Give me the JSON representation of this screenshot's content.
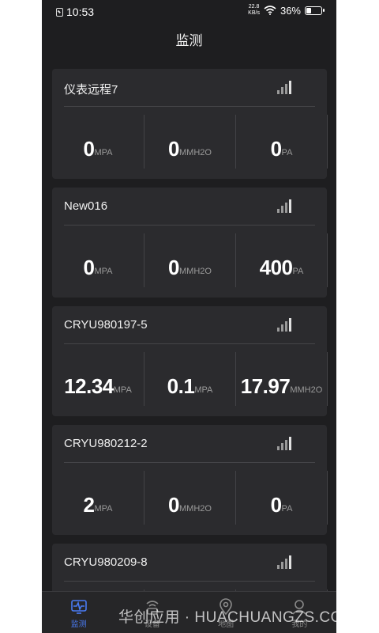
{
  "status_bar": {
    "time": "10:53",
    "net_speed_value": "22.8",
    "net_speed_unit": "KB/s",
    "battery_pct": "36%",
    "battery_level": 0.36
  },
  "title": "监测",
  "devices": [
    {
      "name": "仪表远程7",
      "readings": [
        {
          "value": "0",
          "unit": "MPA"
        },
        {
          "value": "0",
          "unit": "MMH2O"
        },
        {
          "value": "0",
          "unit": "PA"
        }
      ]
    },
    {
      "name": "New016",
      "readings": [
        {
          "value": "0",
          "unit": "MPA"
        },
        {
          "value": "0",
          "unit": "MMH2O"
        },
        {
          "value": "400",
          "unit": "PA"
        }
      ]
    },
    {
      "name": "CRYU980197-5",
      "readings": [
        {
          "value": "12.34",
          "unit": "MPA"
        },
        {
          "value": "0.1",
          "unit": "MPA"
        },
        {
          "value": "17.97",
          "unit": "MMH2O"
        }
      ]
    },
    {
      "name": "CRYU980212-2",
      "readings": [
        {
          "value": "2",
          "unit": "MPA"
        },
        {
          "value": "0",
          "unit": "MMH2O"
        },
        {
          "value": "0",
          "unit": "PA"
        }
      ]
    },
    {
      "name": "CRYU980209-8",
      "readings": [
        {
          "value": "",
          "unit": ""
        },
        {
          "value": "",
          "unit": ""
        },
        {
          "value": "",
          "unit": ""
        }
      ]
    }
  ],
  "tabs": [
    {
      "label": "监测",
      "icon": "monitor-icon",
      "active": true
    },
    {
      "label": "设备",
      "icon": "device-icon",
      "active": false
    },
    {
      "label": "地图",
      "icon": "map-pin-icon",
      "active": false
    },
    {
      "label": "我的",
      "icon": "profile-icon",
      "active": false
    }
  ],
  "watermark": "华创应用 · HUACHUANGZS.COM",
  "colors": {
    "accent": "#4a7cf5",
    "background": "#1e1e20",
    "card": "#2b2b2e"
  }
}
